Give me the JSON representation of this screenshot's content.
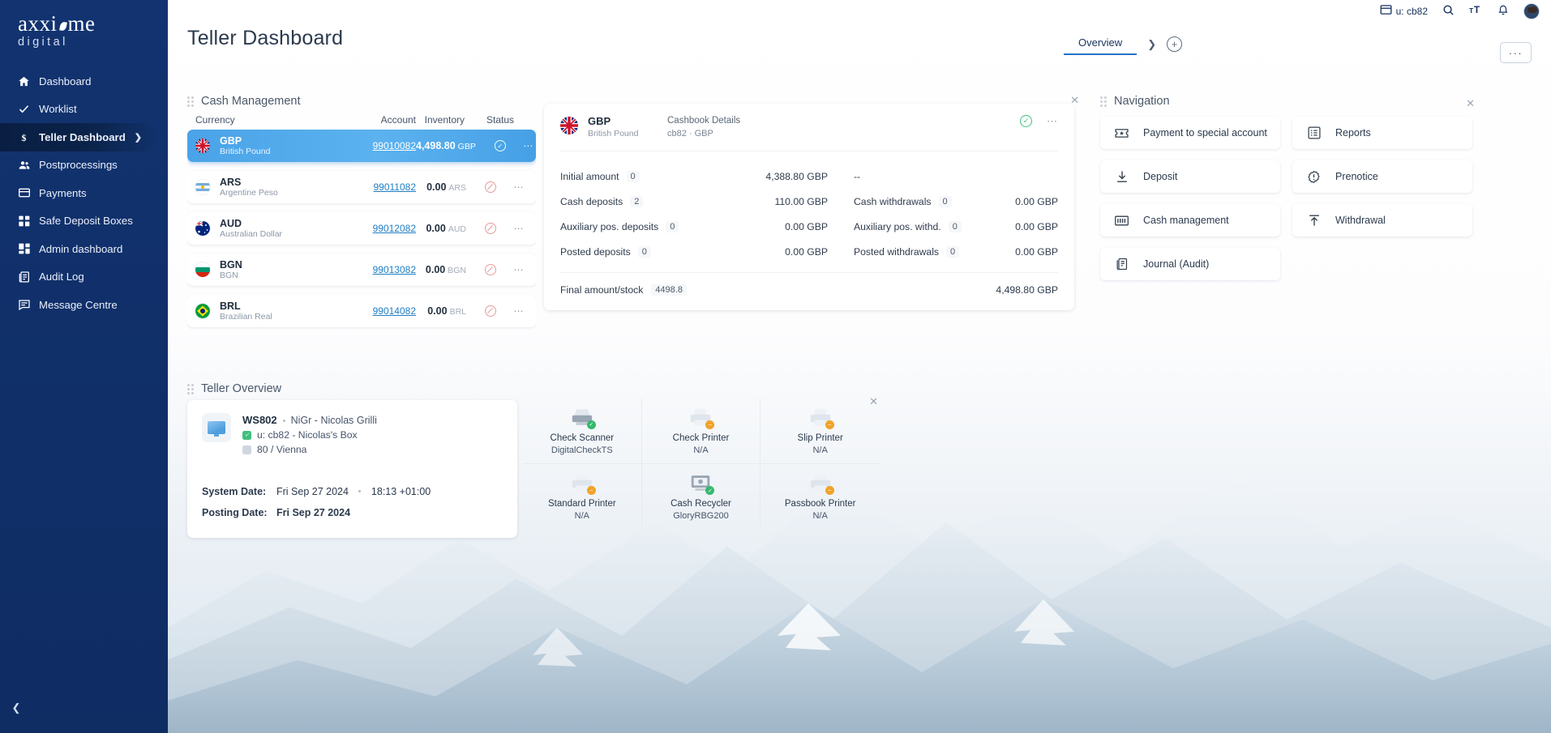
{
  "brand": {
    "name": "axxiome",
    "sub": "digital"
  },
  "sidebar": {
    "items": [
      {
        "label": "Dashboard",
        "icon": "home-icon"
      },
      {
        "label": "Worklist",
        "icon": "check-icon"
      },
      {
        "label": "Teller Dashboard",
        "icon": "dollar-icon"
      },
      {
        "label": "Postprocessings",
        "icon": "users-icon"
      },
      {
        "label": "Payments",
        "icon": "card-icon"
      },
      {
        "label": "Safe Deposit Boxes",
        "icon": "boxes-icon"
      },
      {
        "label": "Admin dashboard",
        "icon": "grid-icon"
      },
      {
        "label": "Audit Log",
        "icon": "book-icon"
      },
      {
        "label": "Message Centre",
        "icon": "message-icon"
      }
    ],
    "active_index": 2,
    "collapse_icon": "chevron-left-icon"
  },
  "topbar": {
    "user": "u: cb82",
    "icons": [
      "card-icon",
      "search-icon",
      "text-size-icon",
      "bell-icon",
      "avatar"
    ]
  },
  "header": {
    "title": "Teller Dashboard",
    "tabs": [
      {
        "label": "Overview",
        "active": true
      }
    ],
    "tab_next_icon": "chevron-right-icon",
    "tab_add_icon": "plus-circle-icon",
    "more_label": "···"
  },
  "cash_management": {
    "title": "Cash Management",
    "columns": [
      "Currency",
      "Account",
      "Inventory",
      "Status"
    ],
    "rows": [
      {
        "code": "GBP",
        "name": "British Pound",
        "account": "99010082",
        "amount": "4,498.80",
        "unit": "GBP",
        "status": "active",
        "selected": true,
        "flag": "gb"
      },
      {
        "code": "ARS",
        "name": "Argentine Peso",
        "account": "99011082",
        "amount": "0.00",
        "unit": "ARS",
        "status": "blocked",
        "selected": false,
        "flag": "ar"
      },
      {
        "code": "AUD",
        "name": "Australian Dollar",
        "account": "99012082",
        "amount": "0.00",
        "unit": "AUD",
        "status": "blocked",
        "selected": false,
        "flag": "au"
      },
      {
        "code": "BGN",
        "name": "BGN",
        "account": "99013082",
        "amount": "0.00",
        "unit": "BGN",
        "status": "blocked",
        "selected": false,
        "flag": "bg"
      },
      {
        "code": "BRL",
        "name": "Brazilian Real",
        "account": "99014082",
        "amount": "0.00",
        "unit": "BRL",
        "status": "blocked",
        "selected": false,
        "flag": "br"
      }
    ]
  },
  "cashbook": {
    "code": "GBP",
    "name": "British Pound",
    "meta_title": "Cashbook Details",
    "meta_sub": "cb82 · GBP",
    "status": "active",
    "lines": [
      {
        "left_label": "Initial amount",
        "left_count": "0",
        "left_value": "4,388.80 GBP",
        "right_label": "",
        "right_count": "",
        "right_value": "--"
      },
      {
        "left_label": "Cash deposits",
        "left_count": "2",
        "left_value": "110.00 GBP",
        "right_label": "Cash withdrawals",
        "right_count": "0",
        "right_value": "0.00 GBP"
      },
      {
        "left_label": "Auxiliary pos. deposits",
        "left_count": "0",
        "left_value": "0.00 GBP",
        "right_label": "Auxiliary pos. withd.",
        "right_count": "0",
        "right_value": "0.00 GBP"
      },
      {
        "left_label": "Posted deposits",
        "left_count": "0",
        "left_value": "0.00 GBP",
        "right_label": "Posted withdrawals",
        "right_count": "0",
        "right_value": "0.00 GBP"
      }
    ],
    "final_label": "Final amount/stock",
    "final_count": "4498.8",
    "final_value": "4,498.80 GBP"
  },
  "navigation": {
    "title": "Navigation",
    "buttons": [
      {
        "label": "Payment to special account",
        "icon": "ticket-icon"
      },
      {
        "label": "Reports",
        "icon": "list-report-icon"
      },
      {
        "label": "Deposit",
        "icon": "download-arrow-icon"
      },
      {
        "label": "Prenotice",
        "icon": "alert-badge-icon"
      },
      {
        "label": "Cash management",
        "icon": "banknote-icon"
      },
      {
        "label": "Withdrawal",
        "icon": "upload-arrow-icon"
      },
      {
        "label": "Journal (Audit)",
        "icon": "journal-icon"
      }
    ]
  },
  "teller_overview": {
    "title": "Teller Overview",
    "workstation": "WS802",
    "user": "NiGr - Nicolas Grilli",
    "box": "u: cb82 - Nicolas's Box",
    "branch": "80 / Vienna",
    "system_date_label": "System Date:",
    "system_date": "Fri Sep 27 2024",
    "system_time": "18:13 +01:00",
    "posting_date_label": "Posting Date:",
    "posting_date": "Fri Sep 27 2024"
  },
  "devices": [
    {
      "name": "Check Scanner",
      "status": "DigitalCheckTS",
      "state": "ok",
      "icon": "scanner-icon"
    },
    {
      "name": "Check Printer",
      "status": "N/A",
      "state": "warn",
      "icon": "printer-icon"
    },
    {
      "name": "Slip Printer",
      "status": "N/A",
      "state": "warn",
      "icon": "printer-icon"
    },
    {
      "name": "Standard Printer",
      "status": "N/A",
      "state": "warn",
      "icon": "printer-icon"
    },
    {
      "name": "Cash Recycler",
      "status": "GloryRBG200",
      "state": "ok",
      "icon": "recycler-icon"
    },
    {
      "name": "Passbook Printer",
      "status": "N/A",
      "state": "warn",
      "icon": "printer-icon"
    }
  ],
  "colors": {
    "sidebar": "#11316b",
    "accent": "#2573c7",
    "row_selected": "#4aa3e8",
    "ok": "#35b96e",
    "warn": "#f0a32a",
    "blocked": "#e79b9b",
    "link": "#1f7ec4"
  }
}
